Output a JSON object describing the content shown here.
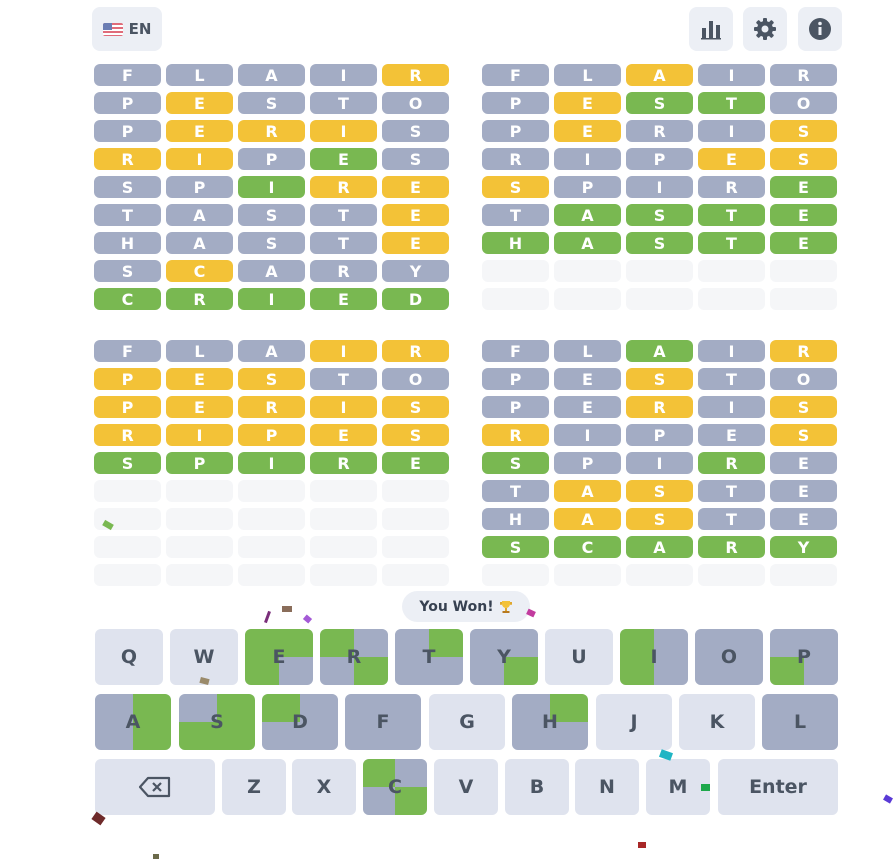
{
  "colors": {
    "gray": "#a3acc4",
    "yellow": "#f3c237",
    "green": "#79b851",
    "empty": "#f5f6f8",
    "key": "#dfe3ee"
  },
  "header": {
    "language_label": "EN",
    "icons": [
      "stats-icon",
      "settings-icon",
      "info-icon"
    ]
  },
  "boards": [
    {
      "rows": [
        {
          "letters": "FLAIR",
          "states": "ggg yy"
        },
        {
          "letters": "PESTO",
          "states": "gyggg"
        },
        {
          "letters": "PERIS",
          "states": "gyyyg"
        },
        {
          "letters": "RIPES",
          "states": "yygng"
        },
        {
          "letters": "SPIRE",
          "states": "ggnyy"
        },
        {
          "letters": "TASTE",
          "states": "ggggy"
        },
        {
          "letters": "HASTE",
          "states": "ggggy"
        },
        {
          "letters": "SCARY",
          "states": "gyggg"
        },
        {
          "letters": "CRIED",
          "states": "nnnnn"
        }
      ]
    },
    {
      "rows": [
        {
          "letters": "FLAIR",
          "states": "ggygg"
        },
        {
          "letters": "PESTO",
          "states": "gynng"
        },
        {
          "letters": "PERIS",
          "states": "gyggy"
        },
        {
          "letters": "RIPES",
          "states": "gggyy"
        },
        {
          "letters": "SPIRE",
          "states": "ygggn"
        },
        {
          "letters": "TASTE",
          "states": "gnnnn"
        },
        {
          "letters": "HASTE",
          "states": "nnnnn"
        },
        {
          "letters": "",
          "states": "eeeee"
        },
        {
          "letters": "",
          "states": "eeeee"
        }
      ]
    },
    {
      "rows": [
        {
          "letters": "FLAIR",
          "states": "gggyy"
        },
        {
          "letters": "PESTO",
          "states": "yyygg"
        },
        {
          "letters": "PERIS",
          "states": "yyyyy"
        },
        {
          "letters": "RIPES",
          "states": "yyyyy"
        },
        {
          "letters": "SPIRE",
          "states": "nnnnn"
        },
        {
          "letters": "",
          "states": "eeeee"
        },
        {
          "letters": "",
          "states": "eeeee"
        },
        {
          "letters": "",
          "states": "eeeee"
        },
        {
          "letters": "",
          "states": "eeeee"
        }
      ]
    },
    {
      "rows": [
        {
          "letters": "FLAIR",
          "states": "ggngy"
        },
        {
          "letters": "PESTO",
          "states": "ggygg"
        },
        {
          "letters": "PERIS",
          "states": "ggygy"
        },
        {
          "letters": "RIPES",
          "states": "ygggy"
        },
        {
          "letters": "SPIRE",
          "states": "nggng"
        },
        {
          "letters": "TASTE",
          "states": "gyygg"
        },
        {
          "letters": "HASTE",
          "states": "gyygg"
        },
        {
          "letters": "SCARY",
          "states": "nnnnn"
        },
        {
          "letters": "",
          "states": "eeeee"
        }
      ]
    }
  ],
  "toast": {
    "text": "You Won!",
    "icon": "trophy-icon"
  },
  "keyboard": {
    "rows": [
      [
        {
          "label": "Q",
          "quads": [
            "",
            "",
            "",
            ""
          ]
        },
        {
          "label": "W",
          "quads": [
            "",
            "",
            "",
            ""
          ]
        },
        {
          "label": "E",
          "quads": [
            "n",
            "n",
            "n",
            "g"
          ]
        },
        {
          "label": "R",
          "quads": [
            "n",
            "g",
            "g",
            "n"
          ]
        },
        {
          "label": "T",
          "quads": [
            "g",
            "n",
            "g",
            "g"
          ]
        },
        {
          "label": "Y",
          "quads": [
            "g",
            "g",
            "g",
            "n"
          ]
        },
        {
          "label": "U",
          "quads": [
            "",
            "",
            "",
            ""
          ]
        },
        {
          "label": "I",
          "quads": [
            "n",
            "g",
            "n",
            "g"
          ]
        },
        {
          "label": "O",
          "quads": [
            "g",
            "g",
            "g",
            "g"
          ]
        },
        {
          "label": "P",
          "quads": [
            "g",
            "g",
            "n",
            "g"
          ]
        }
      ],
      [
        {
          "label": "A",
          "quads": [
            "g",
            "n",
            "g",
            "n"
          ]
        },
        {
          "label": "S",
          "quads": [
            "g",
            "n",
            "n",
            "n"
          ]
        },
        {
          "label": "D",
          "quads": [
            "n",
            "g",
            "g",
            "g"
          ]
        },
        {
          "label": "F",
          "quads": [
            "g",
            "g",
            "g",
            "g"
          ]
        },
        {
          "label": "G",
          "quads": [
            "",
            "",
            "",
            ""
          ]
        },
        {
          "label": "H",
          "quads": [
            "g",
            "n",
            "g",
            "g"
          ]
        },
        {
          "label": "J",
          "quads": [
            "",
            "",
            "",
            ""
          ]
        },
        {
          "label": "K",
          "quads": [
            "",
            "",
            "",
            ""
          ]
        },
        {
          "label": "L",
          "quads": [
            "g",
            "g",
            "g",
            "g"
          ]
        }
      ],
      [
        {
          "label": "",
          "special": "backspace",
          "quads": [
            "",
            "",
            "",
            ""
          ]
        },
        {
          "label": "Z",
          "quads": [
            "",
            "",
            "",
            ""
          ]
        },
        {
          "label": "X",
          "quads": [
            "",
            "",
            "",
            ""
          ]
        },
        {
          "label": "C",
          "quads": [
            "n",
            "g",
            "g",
            "n"
          ]
        },
        {
          "label": "V",
          "quads": [
            "",
            "",
            "",
            ""
          ]
        },
        {
          "label": "B",
          "quads": [
            "",
            "",
            "",
            ""
          ]
        },
        {
          "label": "N",
          "quads": [
            "",
            "",
            "",
            ""
          ]
        },
        {
          "label": "M",
          "quads": [
            "",
            "",
            "",
            ""
          ]
        },
        {
          "label": "Enter",
          "quads": [
            "",
            "",
            "",
            ""
          ]
        }
      ]
    ]
  }
}
